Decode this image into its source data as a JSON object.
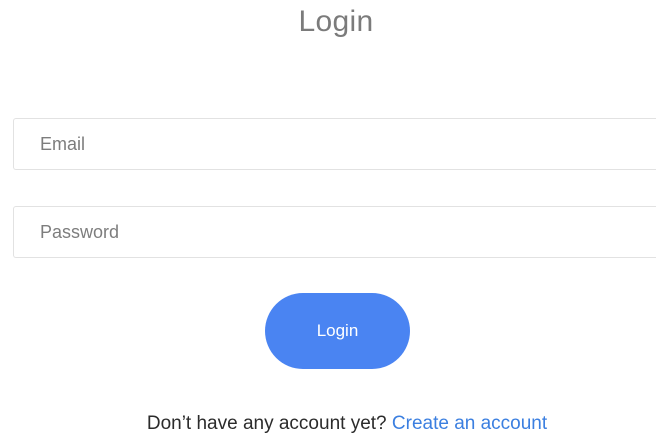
{
  "page": {
    "title": "Login"
  },
  "form": {
    "email_placeholder": "Email",
    "email_value": "",
    "password_placeholder": "Password",
    "password_value": "",
    "submit_label": "Login"
  },
  "footer": {
    "prompt": "Don’t have any account yet?",
    "create_account_link": "Create an account"
  },
  "colors": {
    "accent": "#4a84f2",
    "link": "#3b7fe0"
  }
}
